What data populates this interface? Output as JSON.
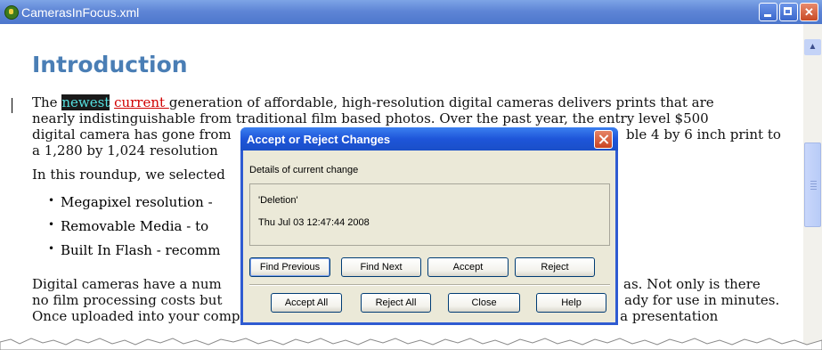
{
  "window": {
    "title": "CamerasInFocus.xml"
  },
  "document": {
    "heading": "Introduction",
    "para1": {
      "before": "The ",
      "deleted": "newest",
      "inserted": "current ",
      "line1_rest": "generation of affordable, high-resolution digital cameras delivers prints that are",
      "line2": "nearly indistinguishable from traditional film based photos. Over the past year, the entry level $500",
      "line3_left": "digital camera has gone from",
      "line3_right": "ble 4 by 6 inch print to",
      "line4_left": "a 1,280 by 1,024 resolution"
    },
    "para2_left": "In this roundup, we selected",
    "bullets": [
      "Megapixel resolution -",
      "Removable Media - to",
      "Built In Flash - recomm"
    ],
    "para3": {
      "line1_left": "Digital cameras have a num",
      "line1_right": "as. Not only is there",
      "line2_left": "no film processing costs but",
      "line2_right": "ady for use in minutes.",
      "line3": "Once uploaded into your computer, the images are ready to post to the web, placed in a presentation"
    }
  },
  "dialog": {
    "title": "Accept or Reject Changes",
    "details_label": "Details of current change",
    "change_type": "'Deletion'",
    "change_time": "Thu Jul 03 12:47:44 2008",
    "buttons_row1": [
      "Find Previous",
      "Find Next",
      "Accept",
      "Reject"
    ],
    "buttons_row2": [
      "Accept All",
      "Reject All",
      "Close",
      "Help"
    ]
  },
  "colors": {
    "heading": "#4a7eb5",
    "deleted_highlight_bg": "#1a1a1a",
    "deleted_highlight_fg": "#55e0e0",
    "inserted": "#d00000",
    "dialog_title": "#1e55d9"
  }
}
